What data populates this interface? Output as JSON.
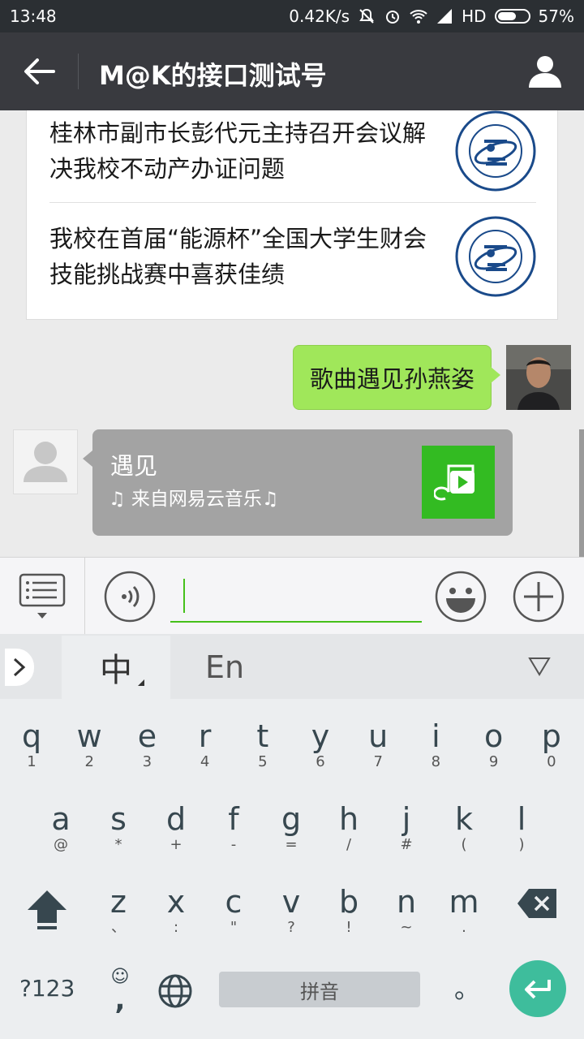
{
  "status_bar": {
    "time": "13:48",
    "network_speed": "0.42K/s",
    "network_type": "HD",
    "battery": "57%",
    "icons": [
      "mute-icon",
      "alarm-icon",
      "wifi-icon",
      "signal-icon",
      "battery-icon"
    ]
  },
  "header": {
    "title": "M@K的接口测试号",
    "back_icon": "arrow-left-icon",
    "profile_icon": "person-icon"
  },
  "chat": {
    "news": [
      {
        "title": "桂林市副市长彭代元主持召开会议解决我校不动产办证问题",
        "thumb": "university-logo"
      },
      {
        "title": "我校在首届“能源杯”全国大学生财会技能挑战赛中喜获佳绩",
        "thumb": "university-logo"
      }
    ],
    "sent_message": "歌曲遇见孙燕姿",
    "music": {
      "title": "遇见",
      "source": "♫ 来自网易云音乐♫"
    }
  },
  "input_bar": {
    "menu_icon": "menu-list-icon",
    "voice_icon": "voice-icon",
    "emoji_icon": "emoji-icon",
    "plus_icon": "plus-icon",
    "value": ""
  },
  "keyboard": {
    "tabs": {
      "chinese": "中",
      "english": "En"
    },
    "row1": [
      {
        "k": "q",
        "s": "1"
      },
      {
        "k": "w",
        "s": "2"
      },
      {
        "k": "e",
        "s": "3"
      },
      {
        "k": "r",
        "s": "4"
      },
      {
        "k": "t",
        "s": "5"
      },
      {
        "k": "y",
        "s": "6"
      },
      {
        "k": "u",
        "s": "7"
      },
      {
        "k": "i",
        "s": "8"
      },
      {
        "k": "o",
        "s": "9"
      },
      {
        "k": "p",
        "s": "0"
      }
    ],
    "row2": [
      {
        "k": "a",
        "s": "@"
      },
      {
        "k": "s",
        "s": "*"
      },
      {
        "k": "d",
        "s": "+"
      },
      {
        "k": "f",
        "s": "-"
      },
      {
        "k": "g",
        "s": "="
      },
      {
        "k": "h",
        "s": "/"
      },
      {
        "k": "j",
        "s": "#"
      },
      {
        "k": "k",
        "s": "("
      },
      {
        "k": "l",
        "s": ")"
      }
    ],
    "row3": [
      {
        "k": "z",
        "s": "、"
      },
      {
        "k": "x",
        "s": ":"
      },
      {
        "k": "c",
        "s": "\""
      },
      {
        "k": "v",
        "s": "?"
      },
      {
        "k": "b",
        "s": "!"
      },
      {
        "k": "n",
        "s": "~"
      },
      {
        "k": "m",
        "s": "."
      }
    ],
    "bottom": {
      "num_label": "?123",
      "comma": ",",
      "emoji_small": "☺",
      "space_label": "拼音",
      "period": "。"
    }
  }
}
